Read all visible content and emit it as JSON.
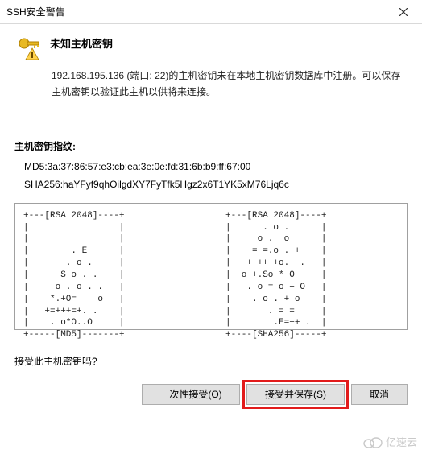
{
  "window": {
    "title": "SSH安全警告"
  },
  "header": {
    "heading": "未知主机密钥",
    "description": "192.168.195.136 (端口: 22)的主机密钥未在本地主机密钥数据库中注册。可以保存主机密钥以验证此主机以供将来连接。"
  },
  "fingerprint": {
    "label": "主机密钥指纹:",
    "md5": "MD5:3a:37:86:57:e3:cb:ea:3e:0e:fd:31:6b:b9:ff:67:00",
    "sha256": "SHA256:haYFyf9qhOilgdXY7FyTfk5Hgz2x6T1YK5xM76Ljq6c"
  },
  "ascii": {
    "rsa": "+---[RSA 2048]----+\n|                 |\n|                 |\n|        . E      |\n|       . o .     |\n|      S o . .    |\n|     o . o . .   |\n|    *.+O=    o   |\n|   +=+++=+. .    |\n|    . o*O..O     |\n+-----[MD5]-------+",
    "sha": "+---[RSA 2048]----+\n|      . o .      |\n|     o .  o      |\n|    = =.o . +    |\n|   + ++ +o.+ .   |\n|  o +.So * O     |\n|   . o = o + O   |\n|    . o . + o    |\n|       . = =     |\n|        .E=++ .  |\n+----[SHA256]-----+"
  },
  "question": "接受此主机密钥吗?",
  "buttons": {
    "once": "一次性接受(O)",
    "accept_save": "接受并保存(S)",
    "cancel": "取消"
  },
  "watermark": "亿速云"
}
